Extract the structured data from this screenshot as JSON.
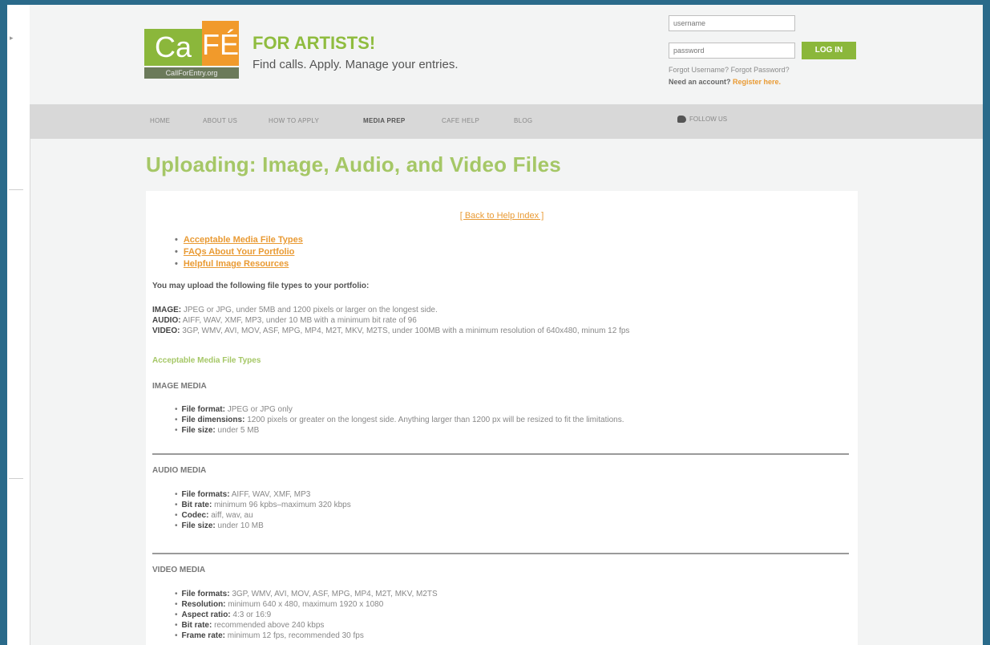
{
  "brand": {
    "logo_ca": "Ca",
    "logo_fe": "FÉ",
    "logo_sub": "CallForEntry.org",
    "title": "FOR ARTISTS!",
    "subtitle": "Find calls. Apply. Manage your entries."
  },
  "login": {
    "username_placeholder": "username",
    "password_placeholder": "password",
    "button": "LOG IN",
    "forgot_username": "Forgot Username?",
    "forgot_password": "Forgot Password?",
    "need_account": "Need an account?",
    "register": "Register here."
  },
  "nav": {
    "items": [
      "HOME",
      "ABOUT US",
      "HOW TO APPLY",
      "MEDIA PREP",
      "CAFE HELP",
      "BLOG"
    ],
    "follow": "FOLLOW US"
  },
  "page": {
    "title": "Uploading: Image, Audio, and Video Files",
    "back_link": "[ Back to Help Index ]",
    "toc": [
      "Acceptable Media File Types",
      "FAQs About Your Portfolio",
      "Helpful Image Resources"
    ],
    "lead": "You may upload the following file types to your portfolio:",
    "summary": [
      {
        "label": "IMAGE:",
        "text": "JPEG or JPG, under 5MB and 1200 pixels or larger on the longest side."
      },
      {
        "label": "AUDIO:",
        "text": "AIFF, WAV, XMF, MP3, under 10 MB with a minimum bit rate of 96"
      },
      {
        "label": "VIDEO:",
        "text": "3GP, WMV, AVI, MOV, ASF, MPG, MP4, M2T, MKV, M2TS, under 100MB with a minimum resolution of 640x480, minum 12 fps"
      }
    ],
    "section_heading": "Acceptable Media File Types",
    "image_media": {
      "title": "IMAGE MEDIA",
      "items": [
        {
          "label": "File format:",
          "text": "JPEG or JPG only"
        },
        {
          "label": "File dimensions:",
          "text": "1200 pixels or greater on the longest side. Anything larger than 1200 px will be resized to fit the limitations."
        },
        {
          "label": "File size:",
          "text": "under 5 MB"
        }
      ]
    },
    "audio_media": {
      "title": "AUDIO MEDIA",
      "items": [
        {
          "label": "File formats:",
          "text": "AIFF, WAV, XMF, MP3"
        },
        {
          "label": "Bit rate:",
          "text": "minimum 96 kpbs–maximum 320 kbps"
        },
        {
          "label": "Codec:",
          "text": "aiff, wav, au"
        },
        {
          "label": "File size:",
          "text": "under 10 MB"
        }
      ]
    },
    "video_media": {
      "title": "VIDEO MEDIA",
      "items": [
        {
          "label": "File formats:",
          "text": "3GP, WMV, AVI, MOV, ASF, MPG, MP4, M2T, MKV, M2TS"
        },
        {
          "label": "Resolution:",
          "text": "minimum 640 x 480, maximum 1920 x 1080"
        },
        {
          "label": "Aspect ratio:",
          "text": "4:3 or 16:9"
        },
        {
          "label": "Bit rate:",
          "text": "recommended above 240 kbps"
        },
        {
          "label": "Frame rate:",
          "text": "minimum 12 fps, recommended 30 fps"
        }
      ]
    }
  }
}
